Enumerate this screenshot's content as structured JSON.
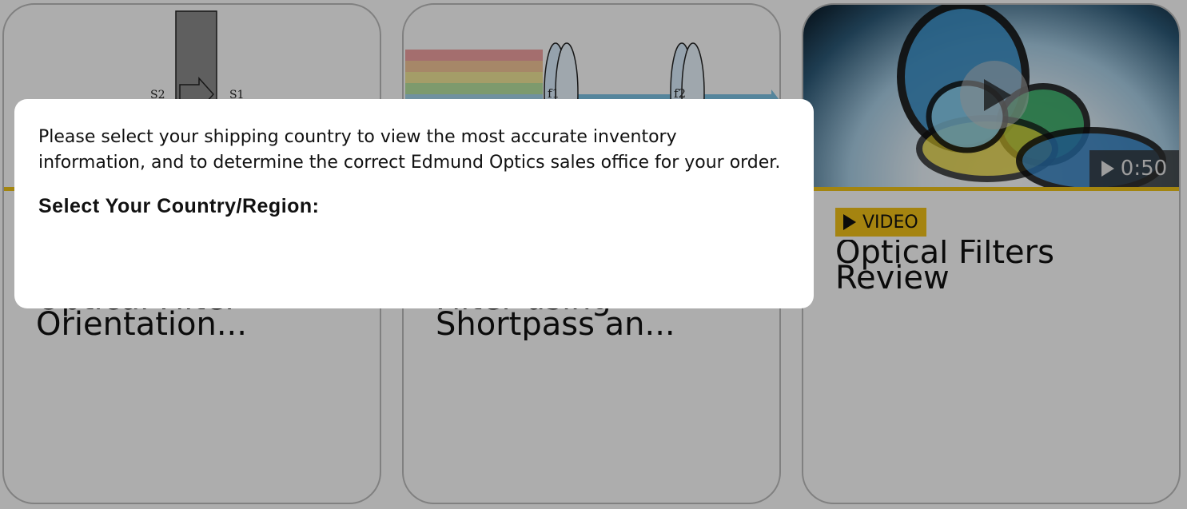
{
  "cards": [
    {
      "title": "Optical Filter Orientation...",
      "image_labels": [
        "S2",
        "S1"
      ]
    },
    {
      "title": "Filter using Shortpass an...",
      "image_labels": [
        "f1",
        "f2"
      ]
    },
    {
      "badge": "VIDEO",
      "title": "Optical Filters Review",
      "duration": "0:50"
    }
  ],
  "modal": {
    "message": "Please select your shipping country to view the most accurate inventory information, and to determine the correct Edmund Optics sales office for your order.",
    "label": "Select Your Country/Region:"
  },
  "colors": {
    "accent_yellow": "#f0c419",
    "overlay": "rgba(0,0,0,0.32)"
  }
}
